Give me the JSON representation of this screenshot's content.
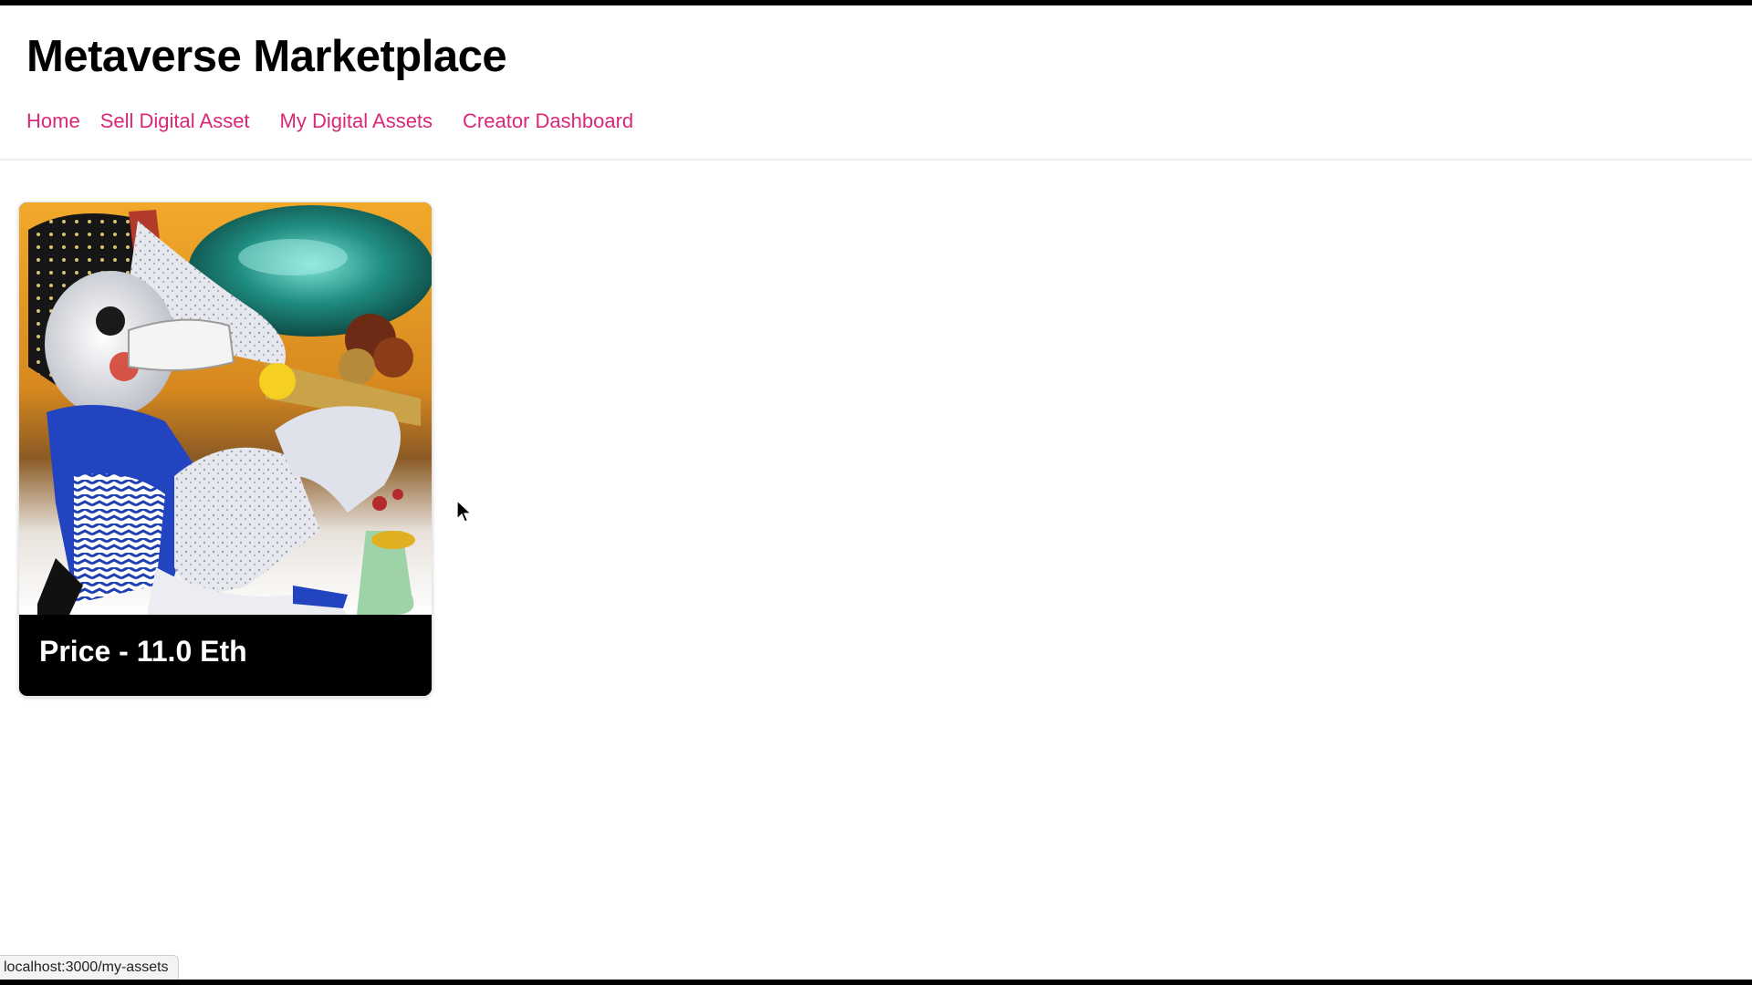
{
  "app": {
    "title": "Metaverse Marketplace"
  },
  "nav": {
    "items": [
      {
        "label": "Home"
      },
      {
        "label": "Sell Digital Asset"
      },
      {
        "label": "My Digital Assets"
      },
      {
        "label": "Creator Dashboard"
      }
    ]
  },
  "assets": [
    {
      "price_label": "Price - 11.0 Eth"
    }
  ],
  "status_bar": {
    "url": "localhost:3000/my-assets"
  },
  "colors": {
    "nav_link": "#db2777",
    "title": "#000000",
    "card_footer": "#000000",
    "price_text": "#ffffff"
  }
}
